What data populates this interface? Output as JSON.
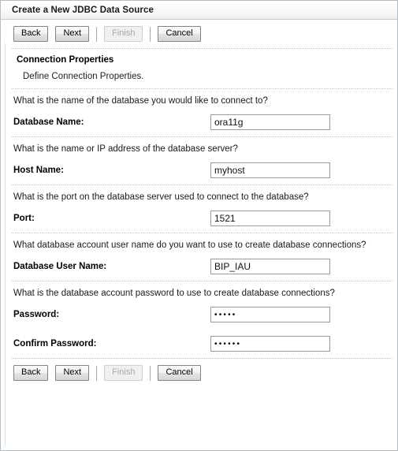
{
  "window": {
    "title": "Create a New JDBC Data Source"
  },
  "toolbar": {
    "back_label": "Back",
    "next_label": "Next",
    "finish_label": "Finish",
    "cancel_label": "Cancel"
  },
  "section": {
    "title": "Connection Properties",
    "description": "Define Connection Properties."
  },
  "fields": [
    {
      "question": "What is the name of the database you would like to connect to?",
      "label": "Database Name:",
      "value": "ora11g",
      "type": "text"
    },
    {
      "question": "What is the name or IP address of the database server?",
      "label": "Host Name:",
      "value": "myhost",
      "type": "text"
    },
    {
      "question": "What is the port on the database server used to connect to the database?",
      "label": "Port:",
      "value": "1521",
      "type": "text"
    },
    {
      "question": "What database account user name do you want to use to create database connections?",
      "label": "Database User Name:",
      "value": "BIP_IAU",
      "type": "text"
    },
    {
      "question": "What is the database account password to use to create database connections?",
      "label": "Password:",
      "value": "•••••",
      "type": "password"
    },
    {
      "question": "",
      "label": "Confirm Password:",
      "value": "••••••",
      "type": "password"
    }
  ],
  "colors": {
    "titlebar_border": "#c4ccd2",
    "separator": "#c3c3c3",
    "input_border": "#9a9a9a",
    "button_border": "#848484",
    "disabled_text": "#a9a9a9"
  }
}
